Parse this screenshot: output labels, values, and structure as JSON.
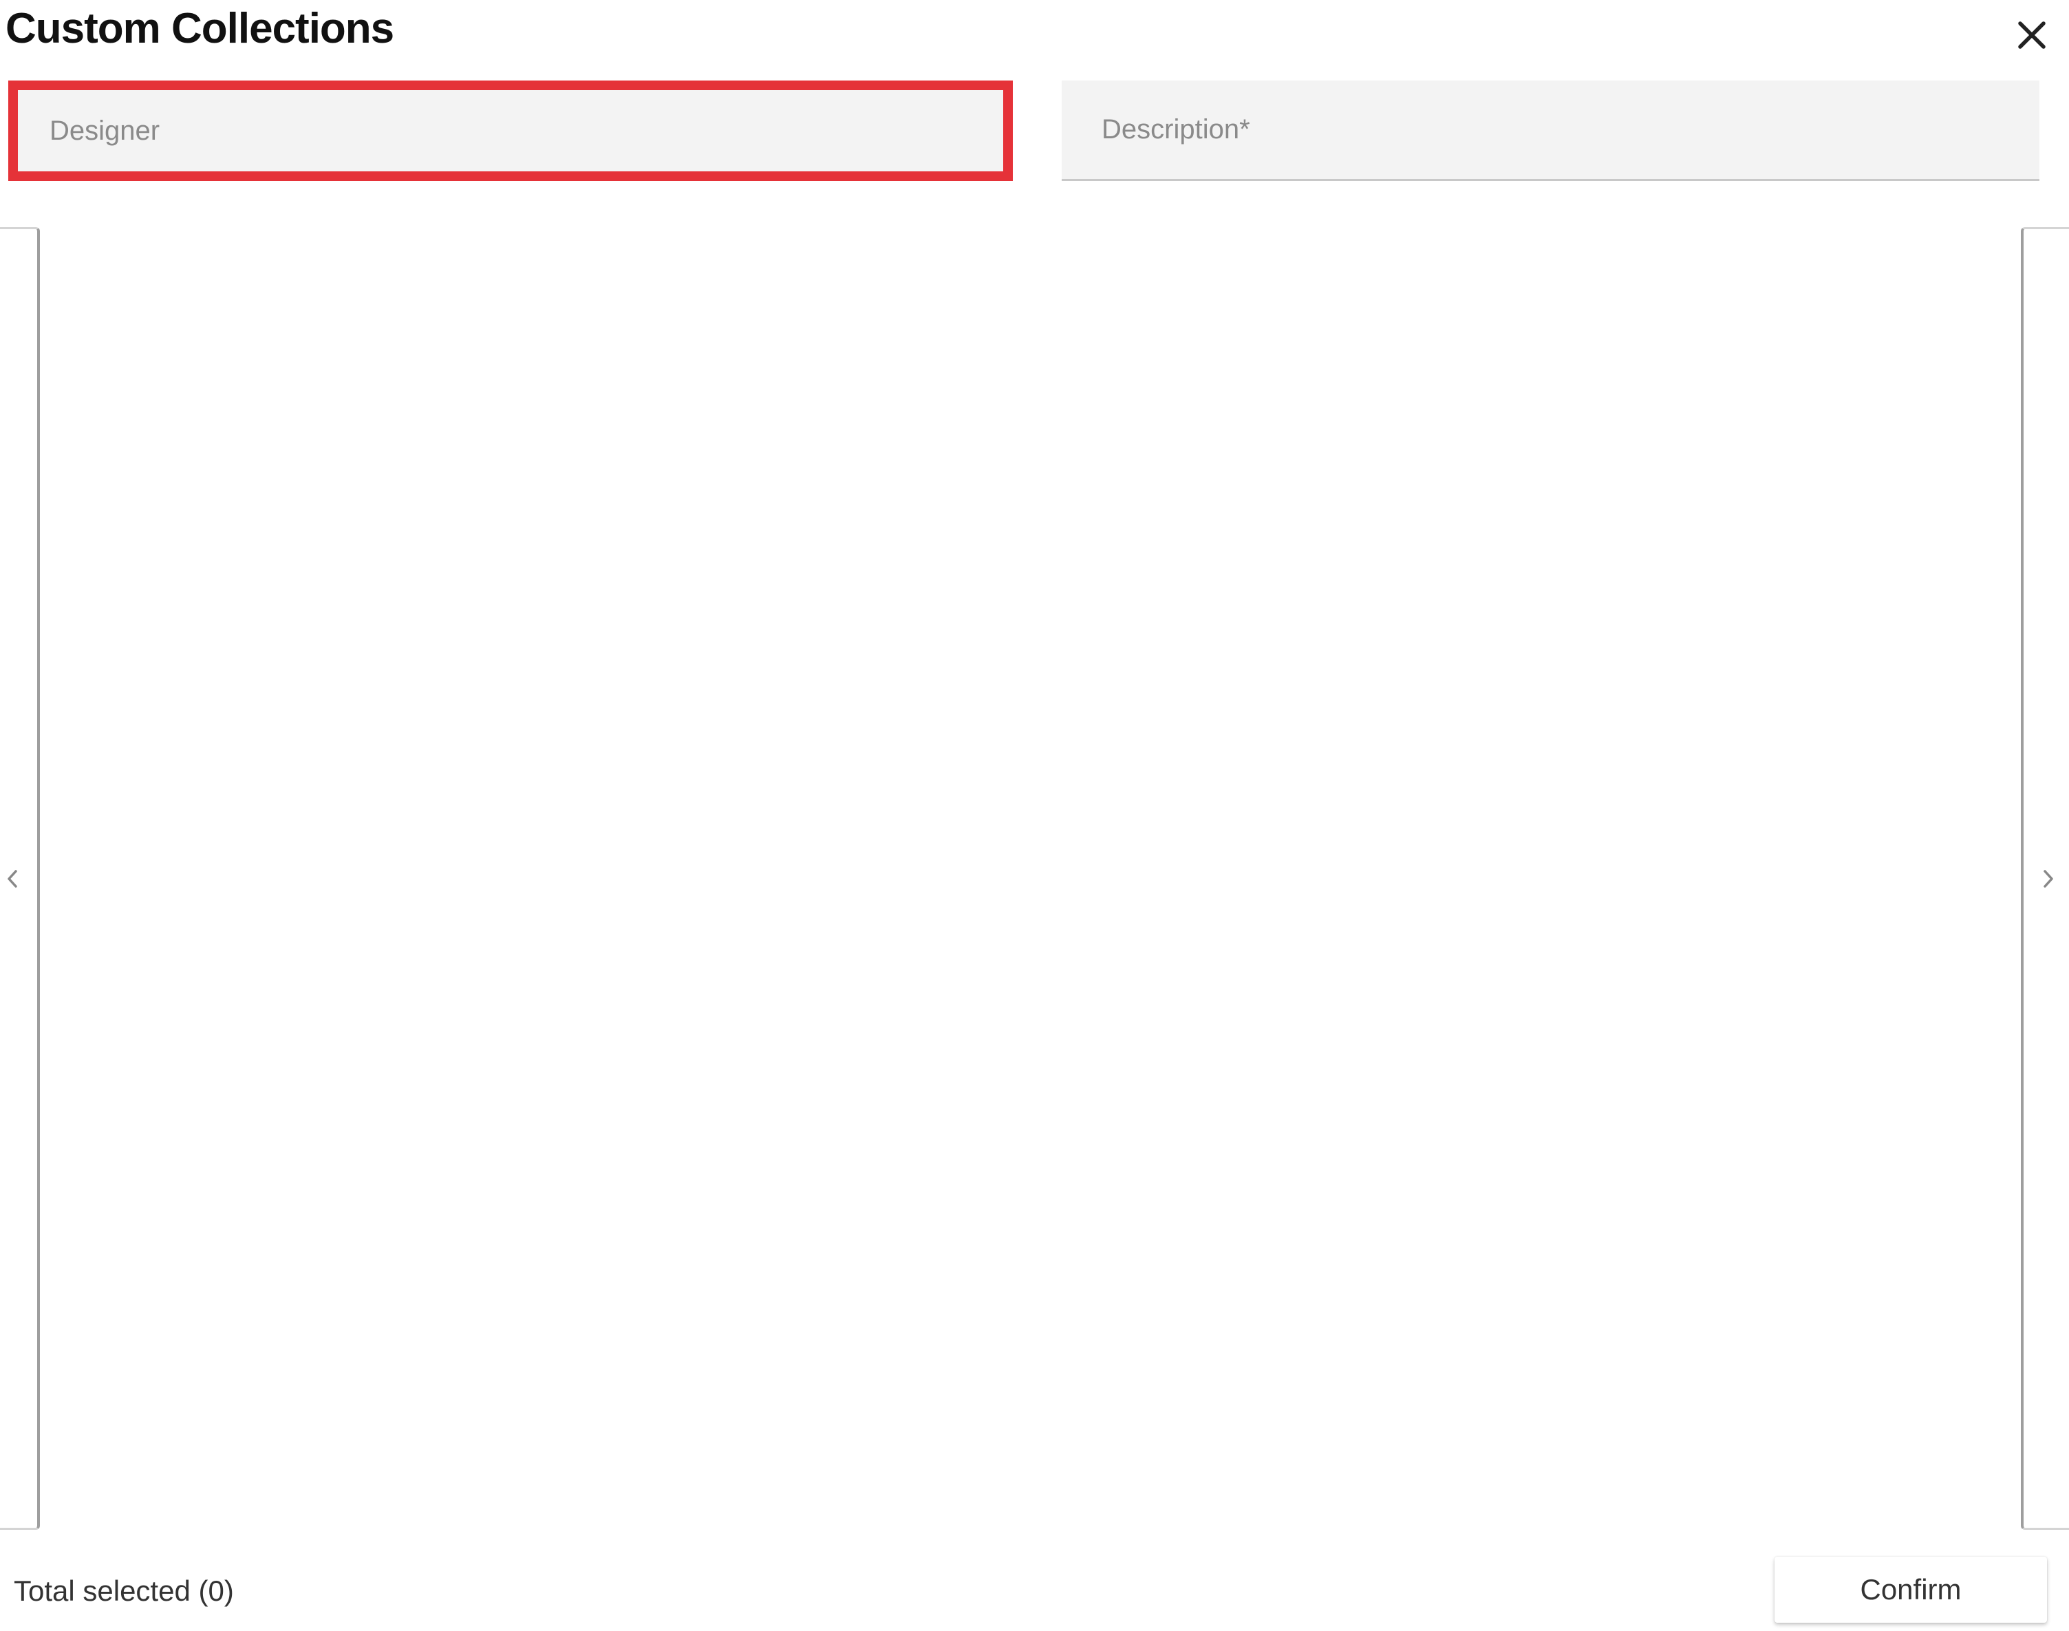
{
  "dialog": {
    "title": "Custom Collections",
    "close_icon": "close-icon"
  },
  "form": {
    "designer": {
      "placeholder": "Designer",
      "value": "",
      "highlight_color": "#e53238"
    },
    "description": {
      "placeholder": "Description*",
      "value": ""
    }
  },
  "carousel": {
    "prev_icon": "chevron-left-icon",
    "next_icon": "chevron-right-icon",
    "items": []
  },
  "footer": {
    "total_selected": "Total selected (0)",
    "confirm_label": "Confirm"
  }
}
